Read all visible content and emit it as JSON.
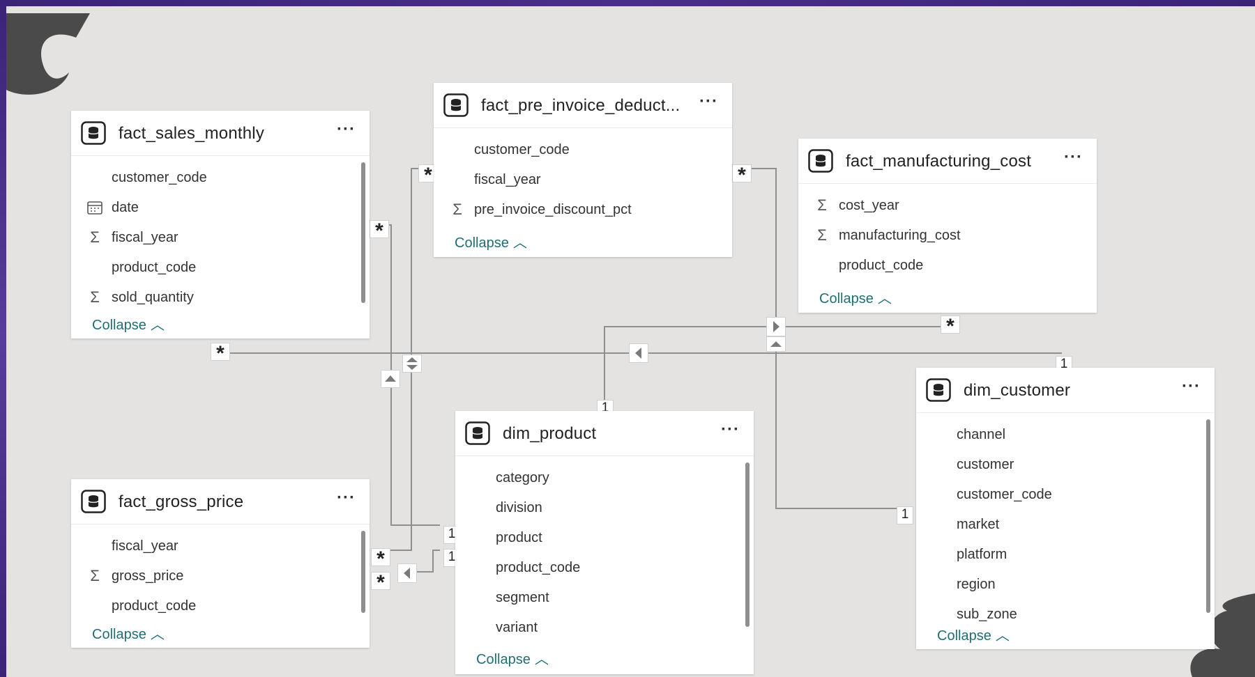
{
  "tables": {
    "fact_sales_monthly": {
      "title": "fact_sales_monthly",
      "fields": [
        {
          "name": "customer_code",
          "icon": "none"
        },
        {
          "name": "date",
          "icon": "calendar-icon"
        },
        {
          "name": "fiscal_year",
          "icon": "sigma-icon"
        },
        {
          "name": "product_code",
          "icon": "none"
        },
        {
          "name": "sold_quantity",
          "icon": "sigma-icon"
        }
      ],
      "collapse": "Collapse"
    },
    "fact_pre_invoice": {
      "title": "fact_pre_invoice_deduct...",
      "fields": [
        {
          "name": "customer_code",
          "icon": "none"
        },
        {
          "name": "fiscal_year",
          "icon": "none"
        },
        {
          "name": "pre_invoice_discount_pct",
          "icon": "sigma-icon"
        }
      ],
      "collapse": "Collapse"
    },
    "fact_manufacturing_cost": {
      "title": "fact_manufacturing_cost",
      "fields": [
        {
          "name": "cost_year",
          "icon": "sigma-icon"
        },
        {
          "name": "manufacturing_cost",
          "icon": "sigma-icon"
        },
        {
          "name": "product_code",
          "icon": "none"
        }
      ],
      "collapse": "Collapse"
    },
    "dim_customer": {
      "title": "dim_customer",
      "fields": [
        {
          "name": "channel",
          "icon": "none"
        },
        {
          "name": "customer",
          "icon": "none"
        },
        {
          "name": "customer_code",
          "icon": "none"
        },
        {
          "name": "market",
          "icon": "none"
        },
        {
          "name": "platform",
          "icon": "none"
        },
        {
          "name": "region",
          "icon": "none"
        },
        {
          "name": "sub_zone",
          "icon": "none"
        }
      ],
      "collapse": "Collapse"
    },
    "dim_product": {
      "title": "dim_product",
      "fields": [
        {
          "name": "category",
          "icon": "none"
        },
        {
          "name": "division",
          "icon": "none"
        },
        {
          "name": "product",
          "icon": "none"
        },
        {
          "name": "product_code",
          "icon": "none"
        },
        {
          "name": "segment",
          "icon": "none"
        },
        {
          "name": "variant",
          "icon": "none"
        }
      ],
      "collapse": "Collapse"
    },
    "fact_gross_price": {
      "title": "fact_gross_price",
      "fields": [
        {
          "name": "fiscal_year",
          "icon": "none"
        },
        {
          "name": "gross_price",
          "icon": "sigma-icon"
        },
        {
          "name": "product_code",
          "icon": "none"
        }
      ],
      "collapse": "Collapse"
    }
  },
  "ui": {
    "more_label": "···",
    "collapse_chevron": "︿",
    "many_label": "*",
    "one_label": "1"
  },
  "colors": {
    "line": "#8f8f8f",
    "link": "#1f6f75",
    "canvas": "#e4e3e2"
  }
}
